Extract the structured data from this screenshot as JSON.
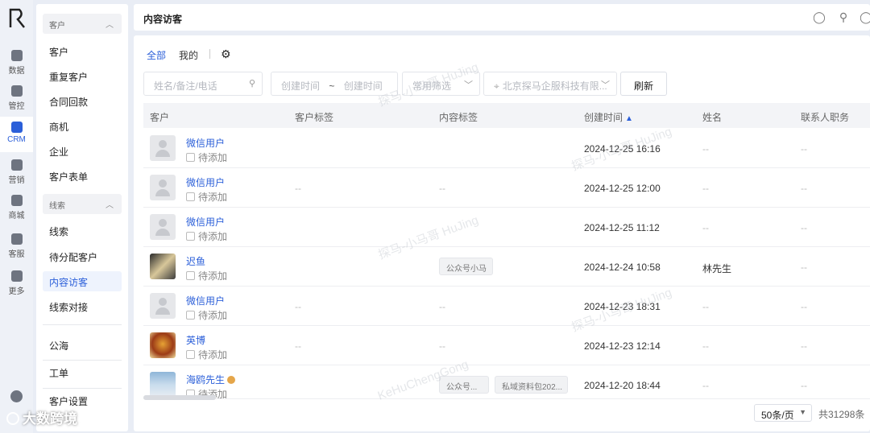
{
  "rail": {
    "items": [
      {
        "label": "数据",
        "icon": "chart-icon"
      },
      {
        "label": "管控",
        "icon": "shield-icon"
      },
      {
        "label": "CRM",
        "icon": "person-icon"
      },
      {
        "label": "营销",
        "icon": "target-icon"
      },
      {
        "label": "商城",
        "icon": "shop-icon"
      },
      {
        "label": "客服",
        "icon": "headset-icon"
      },
      {
        "label": "更多",
        "icon": "grid-icon"
      }
    ]
  },
  "submenu": {
    "groups": [
      {
        "title": "客户",
        "items": [
          "客户",
          "重复客户",
          "合同回款",
          "商机",
          "企业",
          "客户表单"
        ]
      },
      {
        "title": "线索",
        "items": [
          "线索",
          "待分配客户",
          "内容访客",
          "线索对接"
        ]
      }
    ],
    "extra_items": [
      "公海",
      "工单",
      "客户设置"
    ]
  },
  "header": {
    "title": "内容访客"
  },
  "tabs": {
    "all": "全部",
    "mine": "我的"
  },
  "filters": {
    "search_placeholder": "姓名/备注/电话",
    "date_start": "创建时间",
    "date_sep": "~",
    "date_end": "创建时间",
    "common_filter": "常用筛选",
    "org": "北京探马企服科技有限...",
    "refresh": "刷新"
  },
  "table": {
    "headers": [
      "客户",
      "客户标签",
      "内容标签",
      "创建时间",
      "姓名",
      "联系人职务"
    ],
    "rows": [
      {
        "name": "微信用户",
        "status": "待添加",
        "customer_tag": "",
        "content_tags": [],
        "created": "2024-12-25 16:16",
        "real_name": "--",
        "position": "--",
        "avatar": "default"
      },
      {
        "name": "微信用户",
        "status": "待添加",
        "customer_tag": "--",
        "content_tags": [],
        "content_dash": "--",
        "created": "2024-12-25 12:00",
        "real_name": "--",
        "position": "--",
        "avatar": "default"
      },
      {
        "name": "微信用户",
        "status": "待添加",
        "customer_tag": "",
        "content_tags": [],
        "created": "2024-12-25 11:12",
        "real_name": "--",
        "position": "--",
        "avatar": "default"
      },
      {
        "name": "迟鱼",
        "status": "待添加",
        "customer_tag": "",
        "content_tags": [
          "公众号小马"
        ],
        "created": "2024-12-24 10:58",
        "real_name": "林先生",
        "position": "--",
        "avatar": "img1"
      },
      {
        "name": "微信用户",
        "status": "待添加",
        "customer_tag": "--",
        "content_tags": [],
        "content_dash": "--",
        "created": "2024-12-23 18:31",
        "real_name": "--",
        "position": "--",
        "avatar": "default"
      },
      {
        "name": "英博",
        "status": "待添加",
        "customer_tag": "--",
        "content_tags": [],
        "content_dash": "--",
        "created": "2024-12-23 12:14",
        "real_name": "--",
        "position": "--",
        "avatar": "img2"
      },
      {
        "name": "海鸥先生",
        "status": "待添加",
        "customer_tag": "",
        "content_tags": [
          "公众号...",
          "私域资料包202..."
        ],
        "created": "2024-12-20 18:44",
        "real_name": "--",
        "position": "--",
        "avatar": "img3"
      }
    ]
  },
  "pager": {
    "page_size": "50条/页",
    "total": "共31298条"
  },
  "watermark": {
    "text": "探马-小马哥 HuJing",
    "text2": "KeHuChengGong"
  },
  "brand": {
    "text": "大数跨境"
  }
}
